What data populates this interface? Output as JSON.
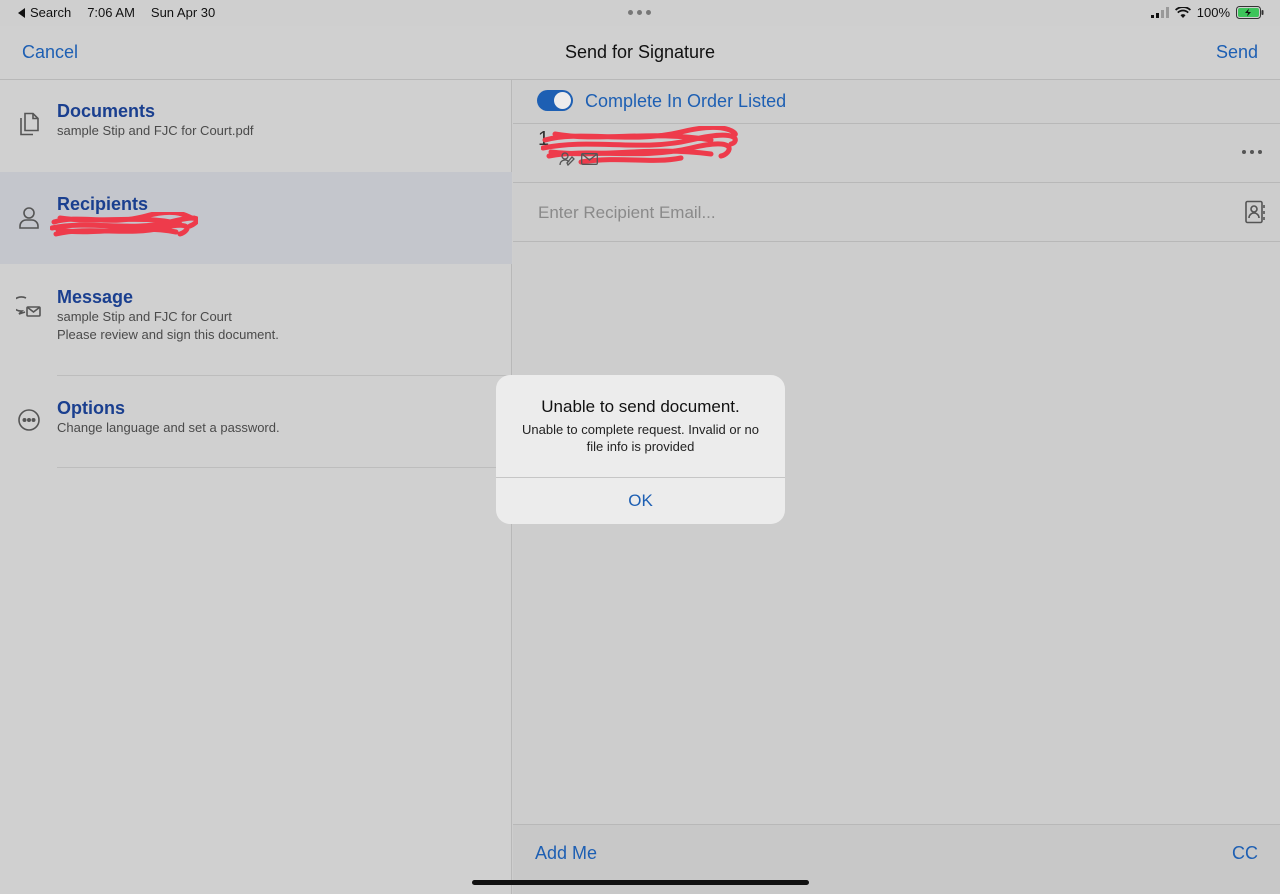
{
  "status_bar": {
    "back_label": "Search",
    "time": "7:06 AM",
    "date": "Sun Apr 30",
    "battery": "100%"
  },
  "nav": {
    "cancel": "Cancel",
    "title": "Send for Signature",
    "send": "Send"
  },
  "sidebar": {
    "items": [
      {
        "title": "Documents",
        "subtitle": "sample Stip and FJC for Court.pdf",
        "icon": "documents-icon"
      },
      {
        "title": "Recipients",
        "subtitle": "",
        "icon": "person-icon"
      },
      {
        "title": "Message",
        "subtitle": "sample Stip and FJC for Court",
        "subtitle2": "Please review and sign this document.",
        "icon": "message-icon"
      },
      {
        "title": "Options",
        "subtitle": "Change language and set a password.",
        "icon": "more-circle-icon"
      }
    ]
  },
  "main": {
    "toggle_label": "Complete In Order Listed",
    "toggle_on": true,
    "recipient_number": "1",
    "email_placeholder": "Enter Recipient Email...",
    "add_me": "Add Me",
    "cc": "CC"
  },
  "alert": {
    "title": "Unable to send document.",
    "message": "Unable to complete request. Invalid or no file info is provided",
    "ok": "OK"
  },
  "colors": {
    "accent": "#1d5fb3",
    "redaction": "#ee3b4b"
  }
}
